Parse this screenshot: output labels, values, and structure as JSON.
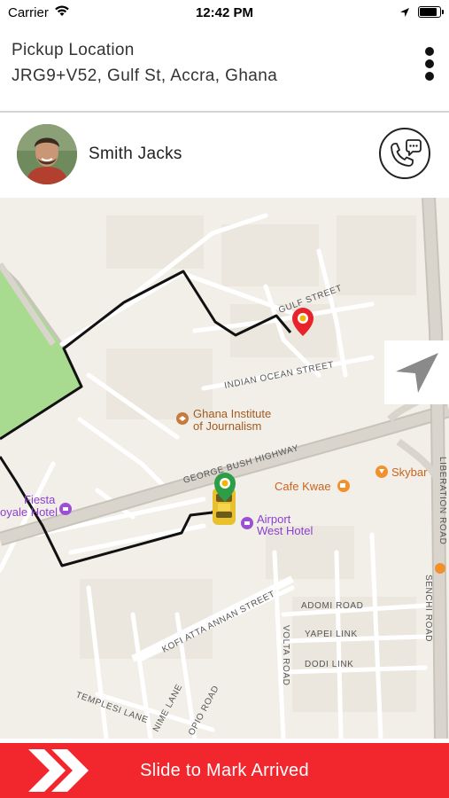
{
  "status_bar": {
    "carrier": "Carrier",
    "time": "12:42 PM",
    "battery_level": 0.95
  },
  "header": {
    "label": "Pickup Location",
    "address": "JRG9+V52, Gulf St, Accra, Ghana"
  },
  "driver": {
    "name": "Smith Jacks"
  },
  "map": {
    "streets": {
      "gulf": "GULF STREET",
      "indian_ocean": "INDIAN OCEAN STREET",
      "george_bush": "GEORGE BUSH HIGHWAY",
      "liberation": "LIBERATION ROAD",
      "kofi_atta": "KOFI ATTA ANNAN STREET",
      "adomi": "ADOMI ROAD",
      "yapei": "YAPEI LINK",
      "dodi": "DODI LINK",
      "volta": "VOLTA ROAD",
      "senchi": "SENCHI ROAD",
      "templesi": "TEMPLESI LANE",
      "nime": "NIME LANE",
      "opio": "OPIO ROAD"
    },
    "pois": {
      "ghana_institute_line1": "Ghana Institute",
      "ghana_institute_line2": "of Journalism",
      "cafe_kwae": "Cafe Kwae",
      "skybar": "Skybar",
      "airport_west_line1": "Airport",
      "airport_west_line2": "West Hotel",
      "fiesta_line1": "Fiesta",
      "fiesta_line2": "oyale Hotel"
    },
    "colors": {
      "route": "#111111",
      "park": "#a8db8f",
      "pickup_pin": "#e8232b",
      "car_pin": "#2e9d47",
      "poi": "#c87a3c",
      "poi_purple": "#9c4fd6"
    }
  },
  "slider": {
    "label": "Slide to Mark Arrived",
    "color": "#f2272d"
  },
  "icons": {
    "wifi": "wifi-icon",
    "location": "location-arrow-icon",
    "battery": "battery-icon",
    "menu": "more-vertical-icon",
    "call": "phone-chat-icon",
    "recenter": "navigation-arrow-icon",
    "slide": "double-chevron-right-icon"
  }
}
